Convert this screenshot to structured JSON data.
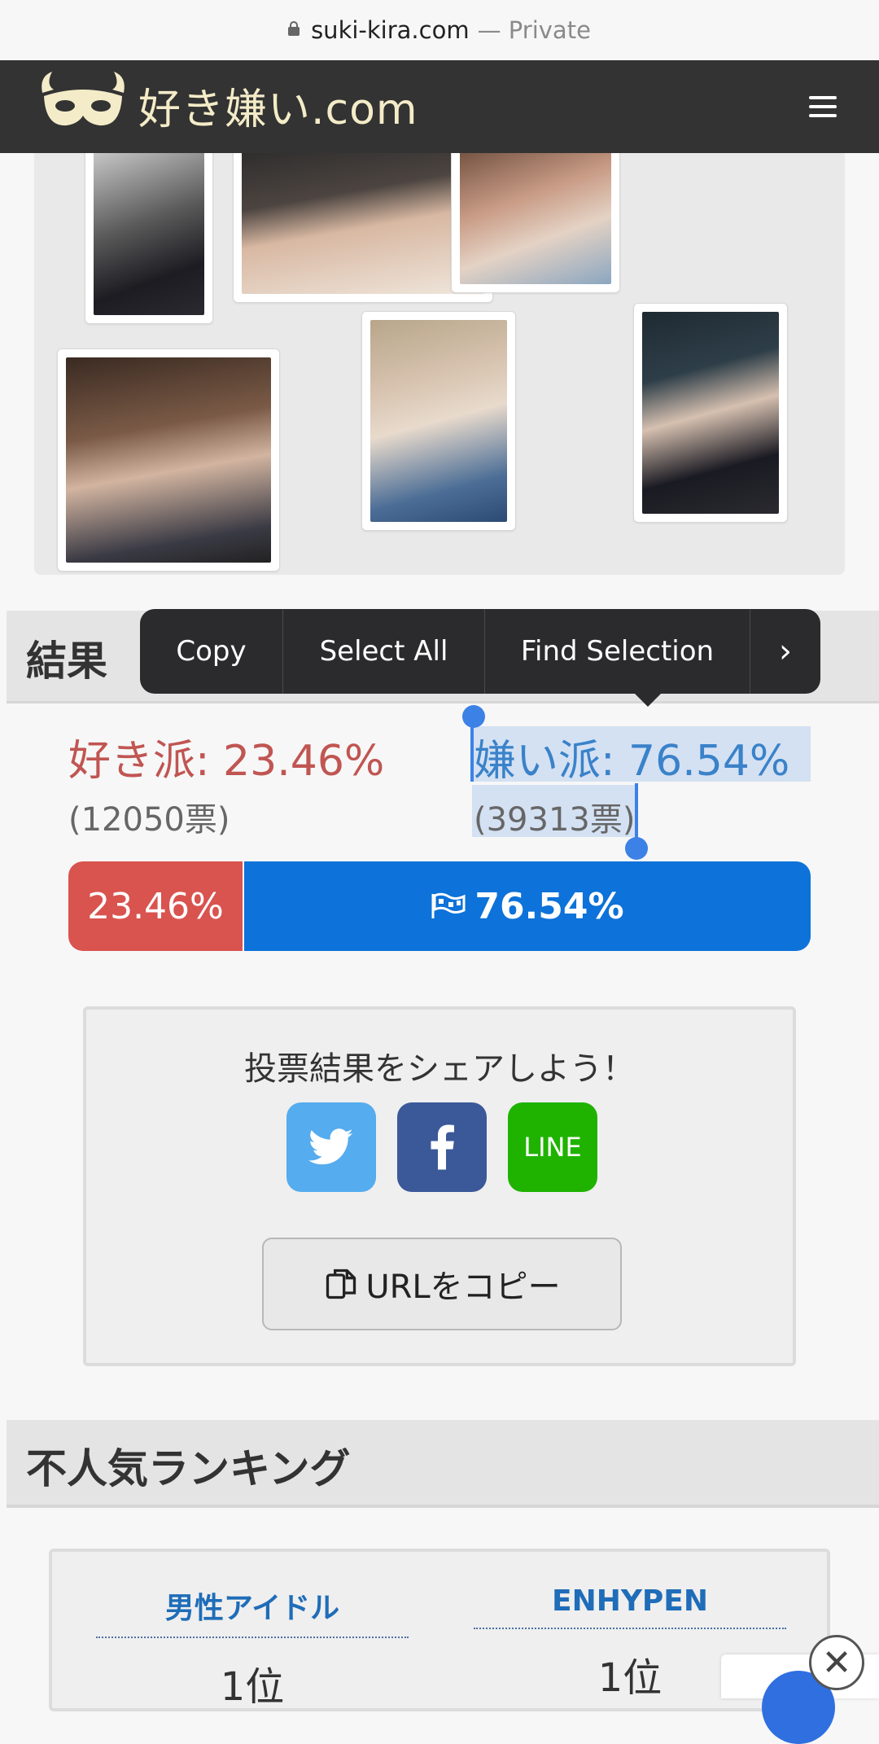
{
  "browser": {
    "domain": "suki-kira.com",
    "mode": "— Private"
  },
  "header": {
    "site_name": "好き嫌い.com"
  },
  "result": {
    "heading": "結果",
    "like_label": "好き派: 23.46%",
    "like_votes": "(12050票)",
    "dislike_label": "嫌い派: 76.54%",
    "dislike_votes": "(39313票)",
    "like_percent": 23.46,
    "dislike_percent": 76.54,
    "bar_like_text": "23.46%",
    "bar_dislike_text": "76.54%"
  },
  "context_menu": {
    "copy": "Copy",
    "select_all": "Select All",
    "find_selection": "Find Selection",
    "more": "›"
  },
  "share": {
    "title": "投票結果をシェアしよう！",
    "line_label": "LINE",
    "copy_url_label": "URLをコピー"
  },
  "ranking": {
    "heading": "不人気ランキング",
    "columns": [
      {
        "category": "男性アイドル",
        "position": "1位"
      },
      {
        "category": "ENHYPEN",
        "position": "1位"
      }
    ]
  },
  "colors": {
    "like": "#d9534f",
    "dislike": "#0d72d9",
    "twitter": "#55acee",
    "facebook": "#3b5998",
    "line": "#1fb300"
  }
}
